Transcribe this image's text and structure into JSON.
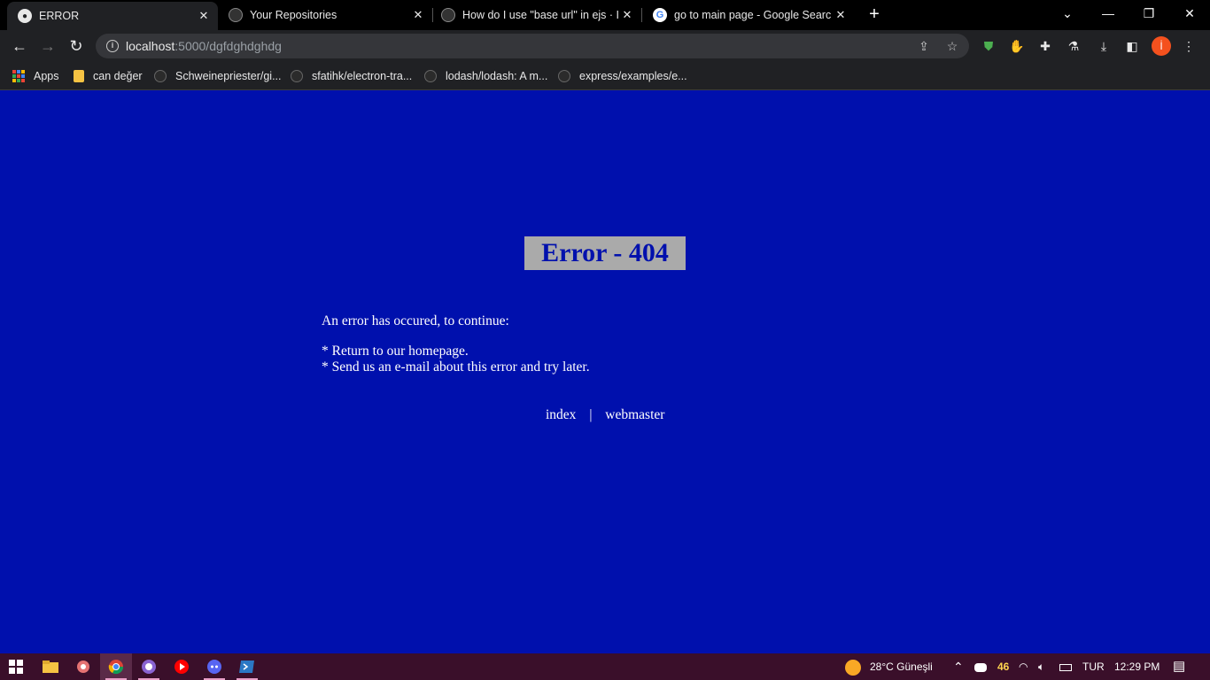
{
  "browser": {
    "tabs": [
      {
        "title": "ERROR",
        "favicon": "globe-icon"
      },
      {
        "title": "Your Repositories",
        "favicon": "github-icon"
      },
      {
        "title": "How do I use \"base url\" in ejs · Is",
        "favicon": "github-icon"
      },
      {
        "title": "go to main page - Google Search",
        "favicon": "google-icon"
      }
    ],
    "address": {
      "host": "localhost",
      "path": ":5000/dgfdghdghdg"
    },
    "profile_initial": "İ",
    "bookmarks": [
      {
        "label": "Apps",
        "icon": "apps-grid-icon"
      },
      {
        "label": "can değer",
        "icon": "folder-icon"
      },
      {
        "label": "Schweinepriester/gi...",
        "icon": "github-icon"
      },
      {
        "label": "sfatihk/electron-tra...",
        "icon": "github-icon"
      },
      {
        "label": "lodash/lodash: A m...",
        "icon": "github-icon"
      },
      {
        "label": "express/examples/e...",
        "icon": "github-icon"
      }
    ]
  },
  "page": {
    "heading": "Error - 404",
    "intro": "An error has occured, to continue:",
    "bullets": [
      "* Return to our homepage.",
      "* Send us an e-mail about this error and try later."
    ],
    "links": {
      "index": "index",
      "separator": "|",
      "webmaster": "webmaster"
    }
  },
  "taskbar": {
    "weather": "28°C  Güneşli",
    "badge": "46",
    "language": "TUR",
    "time": "12:29 PM"
  },
  "colors": {
    "page_bg": "#0010ad",
    "heading_bg": "#aaaaaa",
    "taskbar": "#3a0f2a"
  }
}
